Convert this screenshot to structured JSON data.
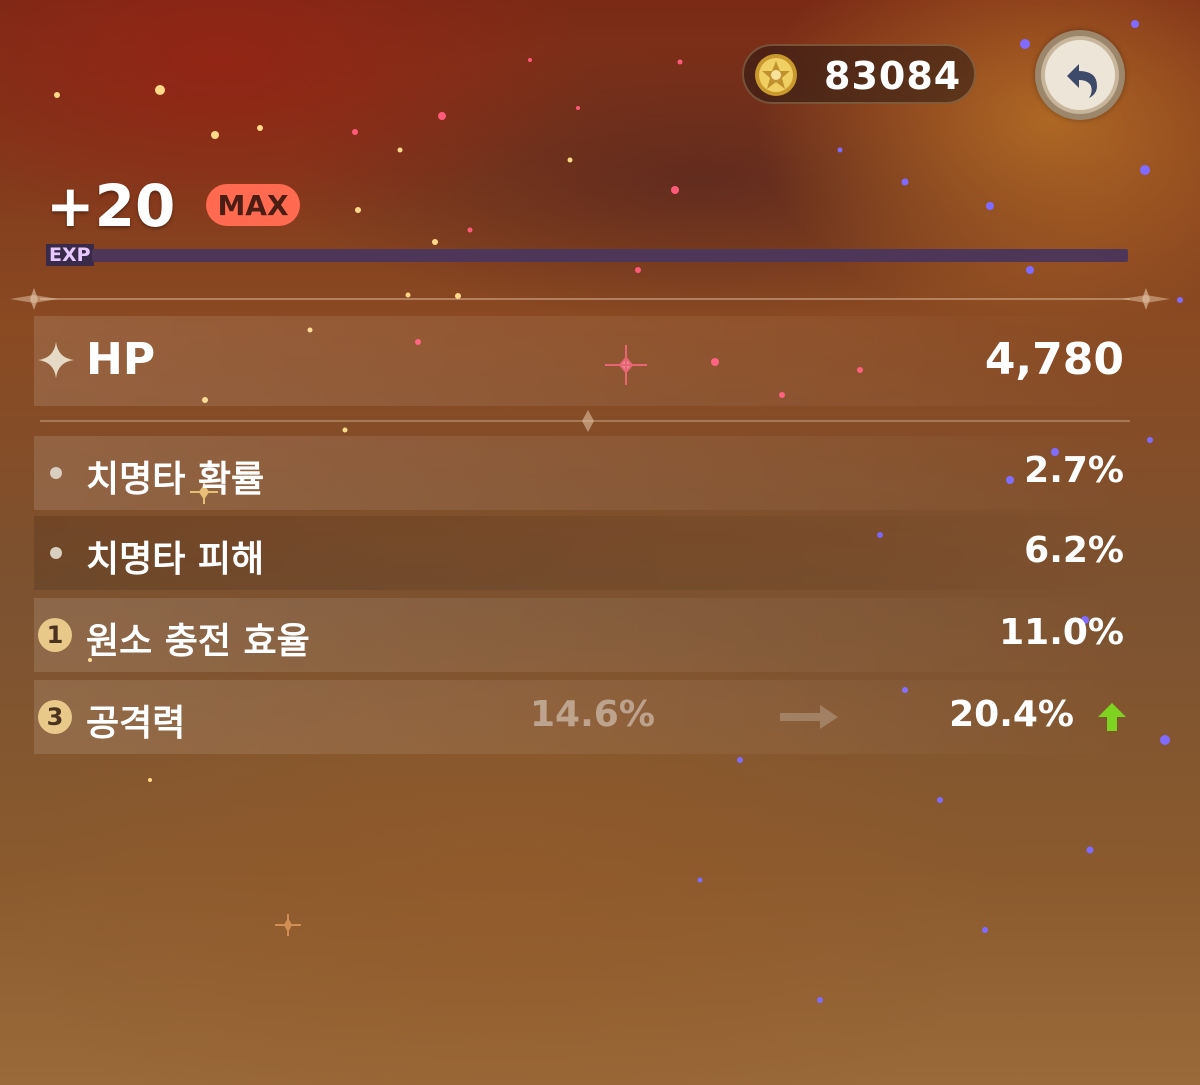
{
  "currency": {
    "icon": "mora-coin-icon",
    "amount": "83084"
  },
  "back_button": {
    "icon": "back-arrow-icon"
  },
  "artifact": {
    "level": "+20",
    "max_badge": "MAX",
    "exp_label": "EXP"
  },
  "main_stat": {
    "label": "HP",
    "value": "4,780",
    "icon": "four-point-star-icon"
  },
  "sub_stats": [
    {
      "label": "치명타 확률",
      "value": "2.7%"
    },
    {
      "label": "치명타 피해",
      "value": "6.2%"
    },
    {
      "label": "원소 충전 효율",
      "value": "11.0%",
      "rolls": "1"
    },
    {
      "label": "공격력",
      "old_value": "14.6%",
      "value": "20.4%",
      "rolls": "3"
    }
  ],
  "colors": {
    "max_badge": "#ff6a50",
    "exp_bar": "#4e3658",
    "increase_arrow": "#7ed321",
    "roll_badge": "#e8c98a"
  }
}
